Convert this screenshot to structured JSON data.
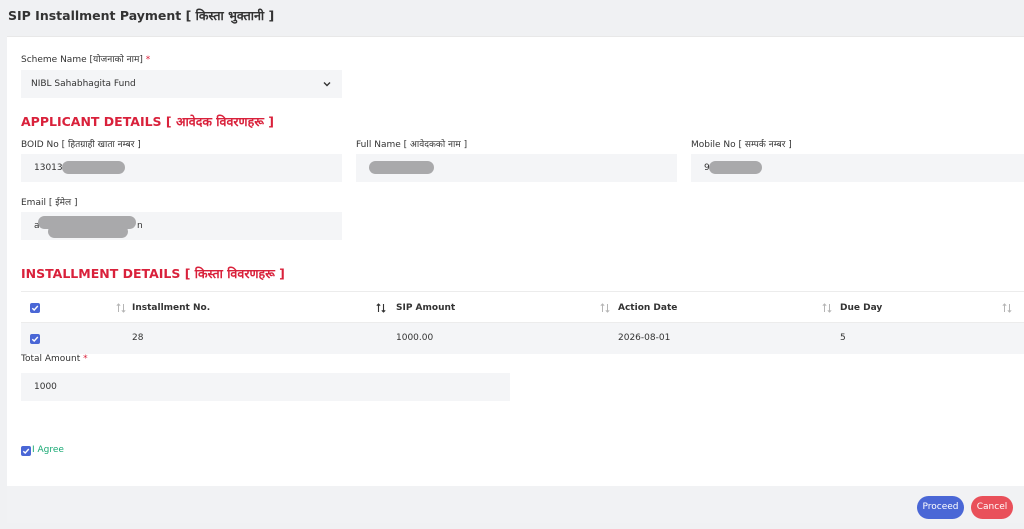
{
  "page": {
    "title": "SIP Installment Payment [ किस्ता भुक्तानी ]"
  },
  "scheme": {
    "label": "Scheme Name [योजनाको नाम]",
    "required": "*",
    "value": "NIBL Sahabhagita Fund"
  },
  "applicant": {
    "section_title": "APPLICANT DETAILS [ आवेदक विवरणहरू ]",
    "boid_label": "BOID No [ हितग्राही खाता नम्बर ]",
    "boid_value": "130137",
    "fullname_label": "Full Name [ आवेदकको नाम ]",
    "fullname_value": "",
    "mobile_label": "Mobile No [ सम्पर्क नम्बर ]",
    "mobile_value": "9",
    "email_label": "Email [ ईमेल ]",
    "email_value_start": "a",
    "email_value_end": "n"
  },
  "installment": {
    "section_title": "INSTALLMENT DETAILS [ किस्ता विवरणहरू ]",
    "columns": [
      "Installment No.",
      "SIP Amount",
      "Action Date",
      "Due Day"
    ],
    "rows": [
      {
        "installment_no": "28",
        "sip_amount": "1000.00",
        "action_date": "2026-08-01",
        "due_day": "5",
        "checked": true
      }
    ]
  },
  "total": {
    "label": "Total Amount",
    "required": "*",
    "value": "1000"
  },
  "agree": {
    "label": "I Agree",
    "checked": true
  },
  "actions": {
    "proceed_label": "Proceed",
    "cancel_label": "Cancel"
  },
  "colors": {
    "accent": "#4a67d6",
    "danger": "#d9213b",
    "cancel": "#e9505a",
    "agree": "#19a974"
  }
}
